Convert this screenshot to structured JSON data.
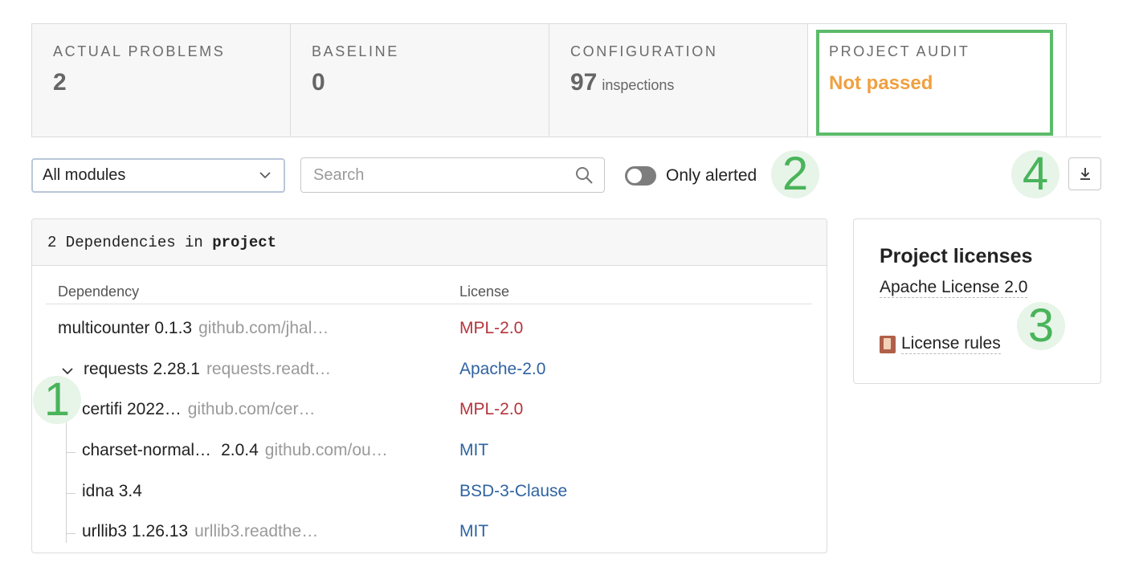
{
  "tabs": [
    {
      "label": "ACTUAL PROBLEMS",
      "value": "2"
    },
    {
      "label": "BASELINE",
      "value": "0"
    },
    {
      "label": "CONFIGURATION",
      "value": "97",
      "sub": "inspections"
    },
    {
      "label": "PROJECT AUDIT",
      "value": "Not passed"
    }
  ],
  "filters": {
    "module_select": "All modules",
    "search_placeholder": "Search",
    "toggle_label": "Only alerted"
  },
  "markers": [
    "1",
    "2",
    "3",
    "4"
  ],
  "dependencies": {
    "header_prefix": "2 Dependencies in ",
    "header_project": "project",
    "col_dependency": "Dependency",
    "col_license": "License",
    "rows": [
      {
        "name": "multicounter",
        "version": "0.1.3",
        "url": "github.com/jhal…",
        "license": "MPL-2.0"
      },
      {
        "name": "requests",
        "version": "2.28.1",
        "url": "requests.readt…",
        "license": "Apache-2.0"
      },
      {
        "name": "certifi 2022…",
        "version": "",
        "url": "github.com/cer…",
        "license": "MPL-2.0"
      },
      {
        "name": "charset-normal…",
        "version": "2.0.4",
        "url": "github.com/ou…",
        "license": "MIT"
      },
      {
        "name": "idna",
        "version": "3.4",
        "url": "",
        "license": "BSD-3-Clause"
      },
      {
        "name": "urllib3",
        "version": "1.26.13",
        "url": "urllib3.readthe…",
        "license": "MIT"
      }
    ]
  },
  "licenses": {
    "title": "Project licenses",
    "item": "Apache License 2.0",
    "rules": "License rules"
  },
  "colors": {
    "accent_green": "#5cbb6a",
    "not_passed": "#f0a040",
    "license_red": "#b5343c",
    "license_blue": "#2f63a0"
  }
}
